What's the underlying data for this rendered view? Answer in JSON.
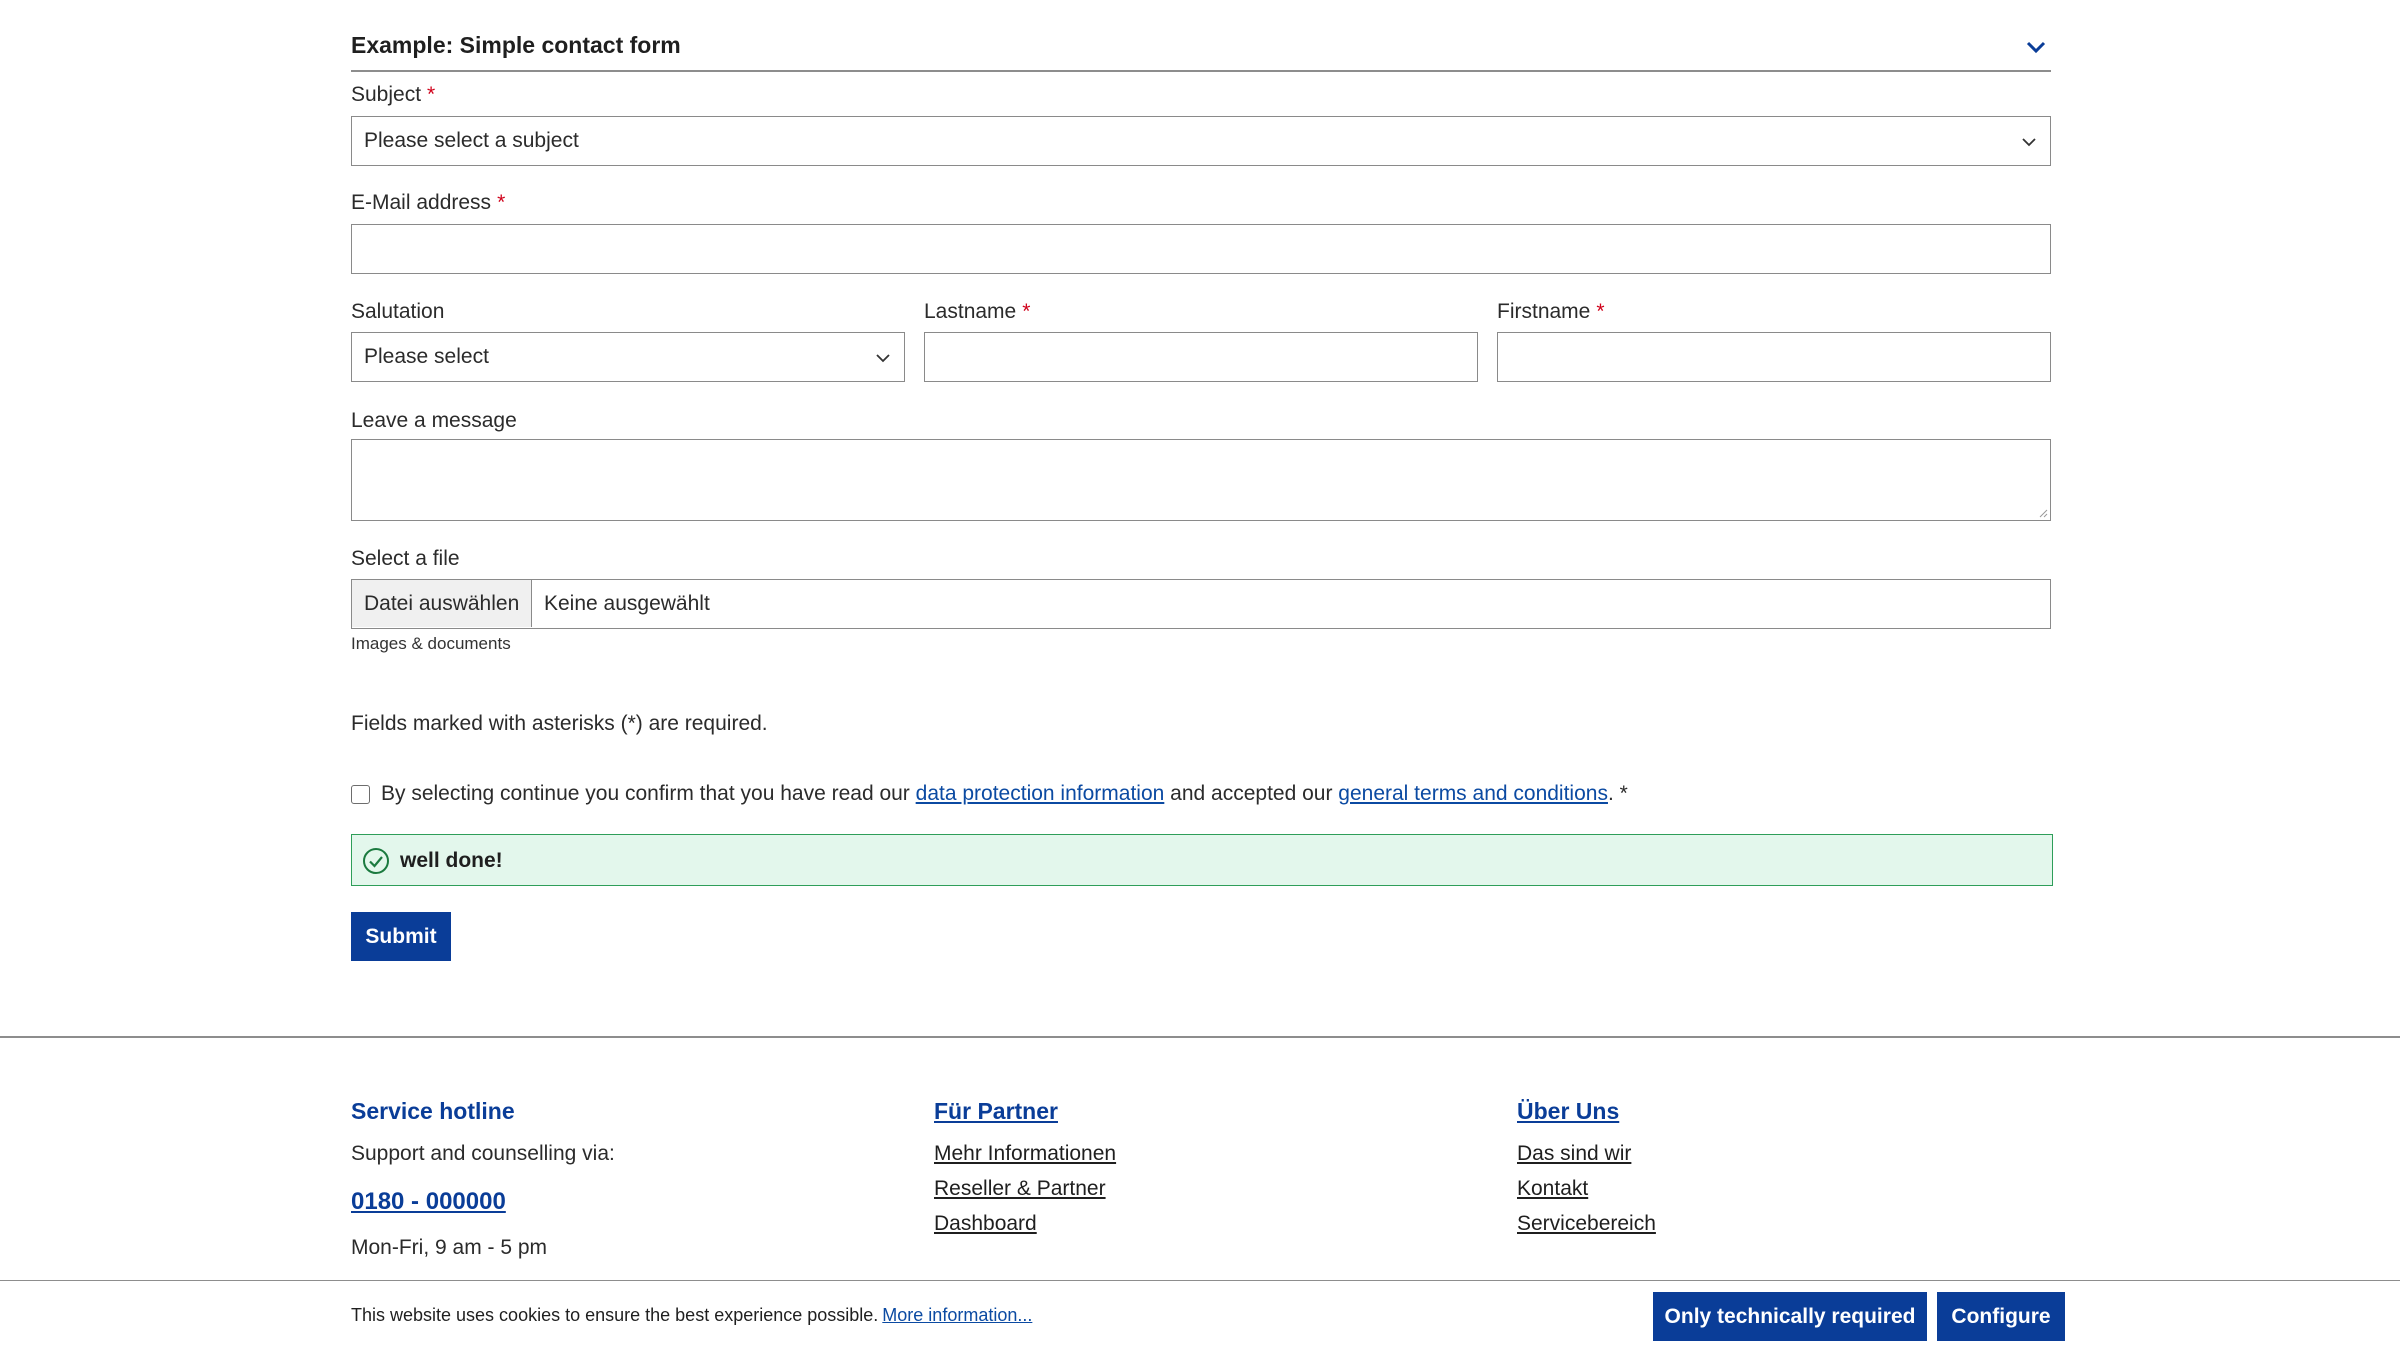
{
  "form": {
    "title": "Example: Simple contact form",
    "subject": {
      "label": "Subject",
      "required_mark": "*",
      "value": "Please select a subject"
    },
    "email": {
      "label": "E-Mail address",
      "required_mark": "*",
      "value": ""
    },
    "salutation": {
      "label": "Salutation",
      "value": "Please select"
    },
    "lastname": {
      "label": "Lastname",
      "required_mark": "*",
      "value": ""
    },
    "firstname": {
      "label": "Firstname",
      "required_mark": "*",
      "value": ""
    },
    "message": {
      "label": "Leave a message",
      "value": ""
    },
    "file": {
      "label": "Select a file",
      "button_label": "Datei auswählen",
      "status": "Keine ausgewählt",
      "hint": "Images & documents"
    },
    "required_note": "Fields marked with asterisks (*) are required.",
    "consent": {
      "checked": false,
      "text_before": "By selecting continue you confirm that you have read our",
      "link1": "data protection information",
      "text_middle": "and accepted our",
      "link2": "general terms and conditions",
      "text_after": ". *"
    },
    "success_message": "well done!",
    "submit_label": "Submit"
  },
  "footer": {
    "service": {
      "title": "Service hotline",
      "subtitle": "Support and counselling via:",
      "phone": "0180 - 000000",
      "hours": "Mon-Fri, 9 am - 5 pm"
    },
    "partner": {
      "title": "Für Partner",
      "links": [
        "Mehr Informationen",
        "Reseller & Partner",
        "Dashboard"
      ]
    },
    "about": {
      "title": "Über Uns",
      "links": [
        "Das sind wir",
        "Kontakt",
        "Servicebereich"
      ]
    }
  },
  "cookie": {
    "text": "This website uses cookies to ensure the best experience possible.",
    "link": "More information...",
    "btn_technical": "Only technically required",
    "btn_configure": "Configure"
  },
  "colors": {
    "primary": "#0a3d98",
    "link": "#0b4aa2",
    "required": "#d0021b",
    "success_bg": "#e3f7ec",
    "success_border": "#2e9e59"
  },
  "icons": {
    "section_toggle": "chevron-down-icon",
    "select": "chevron-down-icon",
    "success": "check-circle-icon"
  }
}
